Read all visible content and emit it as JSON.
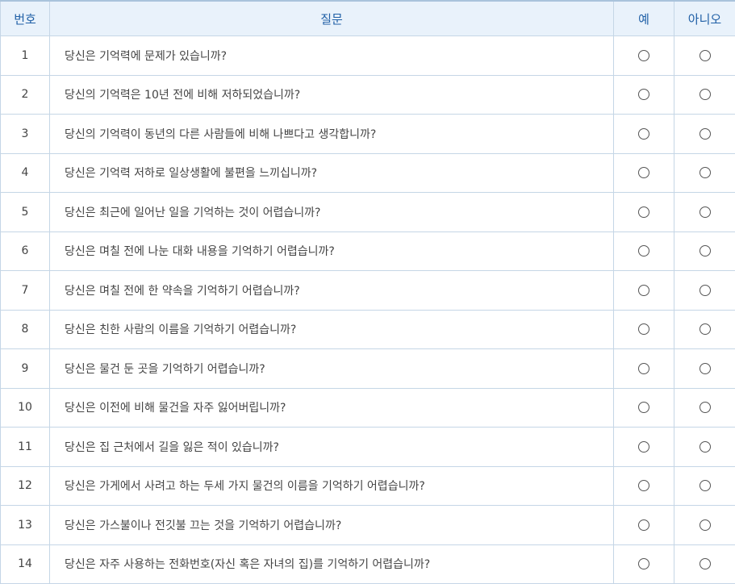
{
  "header": {
    "number": "번호",
    "question": "질문",
    "yes": "예",
    "no": "아니오"
  },
  "rows": [
    {
      "number": "1",
      "question": "당신은 기억력에 문제가 있습니까?"
    },
    {
      "number": "2",
      "question": "당신의 기억력은 10년 전에 비해 저하되었습니까?"
    },
    {
      "number": "3",
      "question": "당신의 기억력이 동년의 다른 사람들에 비해 나쁘다고 생각합니까?"
    },
    {
      "number": "4",
      "question": "당신은 기억력 저하로 일상생활에 불편을 느끼십니까?"
    },
    {
      "number": "5",
      "question": "당신은 최근에 일어난 일을 기억하는 것이 어렵습니까?"
    },
    {
      "number": "6",
      "question": "당신은 며칠 전에 나눈 대화 내용을 기억하기 어렵습니까?"
    },
    {
      "number": "7",
      "question": "당신은 며칠 전에 한 약속을 기억하기 어렵습니까?"
    },
    {
      "number": "8",
      "question": "당신은 친한 사람의 이름을 기억하기 어렵습니까?"
    },
    {
      "number": "9",
      "question": "당신은 물건 둔 곳을 기억하기 어렵습니까?"
    },
    {
      "number": "10",
      "question": "당신은 이전에 비해 물건을 자주 잃어버립니까?"
    },
    {
      "number": "11",
      "question": "당신은 집 근처에서 길을 잃은 적이 있습니까?"
    },
    {
      "number": "12",
      "question": "당신은 가게에서 사려고 하는 두세 가지 물건의 이름을 기억하기 어렵습니까?"
    },
    {
      "number": "13",
      "question": "당신은 가스불이나 전깃불 끄는 것을 기억하기 어렵습니까?"
    },
    {
      "number": "14",
      "question": "당신은 자주 사용하는 전화번호(자신 혹은 자녀의 집)를 기억하기 어렵습니까?"
    }
  ],
  "colors": {
    "header_bg": "#e9f2fb",
    "header_text": "#1f5fa6",
    "border": "#c5d6e6"
  }
}
